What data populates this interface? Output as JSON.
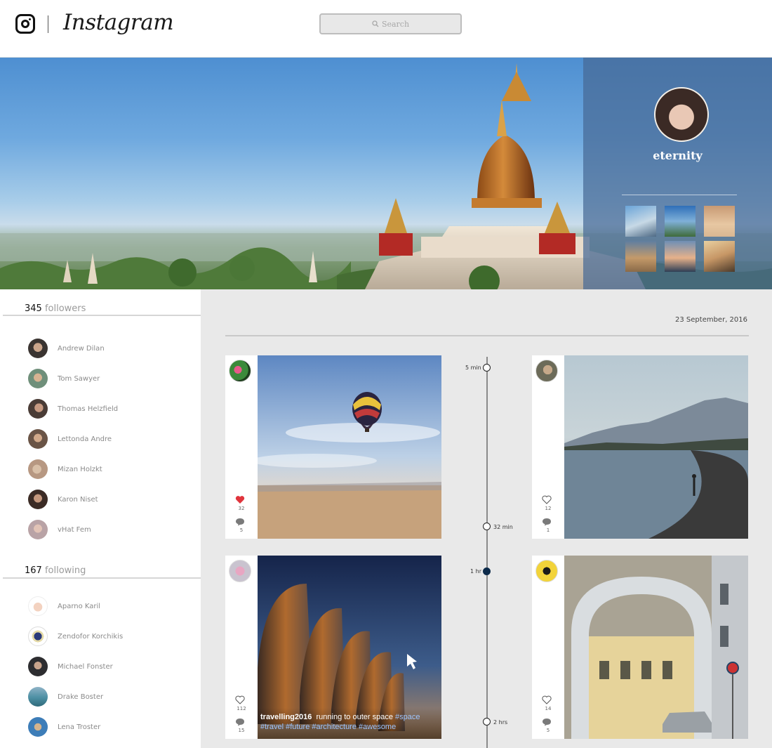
{
  "header": {
    "brand": "Instagram",
    "search": {
      "placeholder": "Search"
    }
  },
  "profile": {
    "username": "eternity",
    "thumbnails": [
      "travel-thumb-1",
      "travel-thumb-2",
      "travel-thumb-3",
      "travel-thumb-4",
      "travel-thumb-5",
      "travel-thumb-6"
    ]
  },
  "followers": {
    "count": "345",
    "label": "followers",
    "people": [
      "Andrew Dilan",
      "Tom Sawyer",
      "Thomas Helzfield",
      "Lettonda Andre",
      "Mizan Holzkt",
      "Karon Niset",
      "vHat Fem"
    ]
  },
  "following": {
    "count": "167",
    "label": "following",
    "people": [
      "Aparno Karil",
      "Zendofor Korchikis",
      "Michael Fonster",
      "Drake Boster",
      "Lena Troster"
    ]
  },
  "feed": {
    "date": "23 September, 2016",
    "posts": [
      {
        "likes": "32",
        "comments": "5",
        "liked": true
      },
      {
        "likes": "12",
        "comments": "1",
        "liked": false
      },
      {
        "likes": "112",
        "comments": "15",
        "liked": false,
        "caption": {
          "user": "travelling2016",
          "text": "running to outer space",
          "tags_line1": "#space",
          "tags_line2": "#travel #future #architecture #awesome"
        }
      },
      {
        "likes": "14",
        "comments": "5",
        "liked": false
      }
    ],
    "timeline": [
      "5 min",
      "32 min",
      "1 hr",
      "2 hrs"
    ]
  },
  "colors": {
    "heart_liked": "#e0343c",
    "profile_overlay": "#46699a",
    "timeline_active": "#0c2a4a",
    "hashtag": "#9ec5ff"
  }
}
